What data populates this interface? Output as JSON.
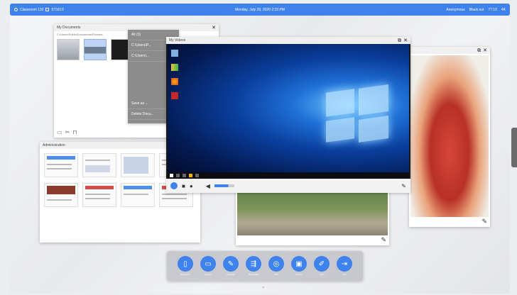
{
  "topbar": {
    "left1": "Classroom 110",
    "left2": "ST1610",
    "datetime": "Monday, July 29, 2020 2:23 PM",
    "right1": "Anonymous",
    "right2": "Black out",
    "right3": "77:10",
    "right4": "4K",
    "accent": "#3f82ec"
  },
  "docs": {
    "title": "My Documents",
    "path": "C:\\Users\\Public\\Documents\\Pictures"
  },
  "grey_panel": {
    "items": [
      "All (3)",
      "C:\\Users\\P...",
      "C:\\Users\\...",
      "Save as ...",
      "Delete Docu..."
    ]
  },
  "admin": {
    "title": "Administration"
  },
  "vm": {
    "title": "My Videos",
    "close": "✕",
    "restore": "⧉"
  },
  "dock": {
    "items": [
      {
        "label": "Document",
        "icon": "document-icon"
      },
      {
        "label": "Screen",
        "icon": "screen-icon"
      },
      {
        "label": "Annotate",
        "icon": "pen-icon"
      },
      {
        "label": "Broadcast",
        "icon": "broadcast-icon"
      },
      {
        "label": "Web",
        "icon": "globe-icon"
      },
      {
        "label": "Toolbox",
        "icon": "toolbox-icon"
      },
      {
        "label": "Tools",
        "icon": "pencil-icon"
      },
      {
        "label": "Exit",
        "icon": "exit-icon"
      }
    ]
  }
}
